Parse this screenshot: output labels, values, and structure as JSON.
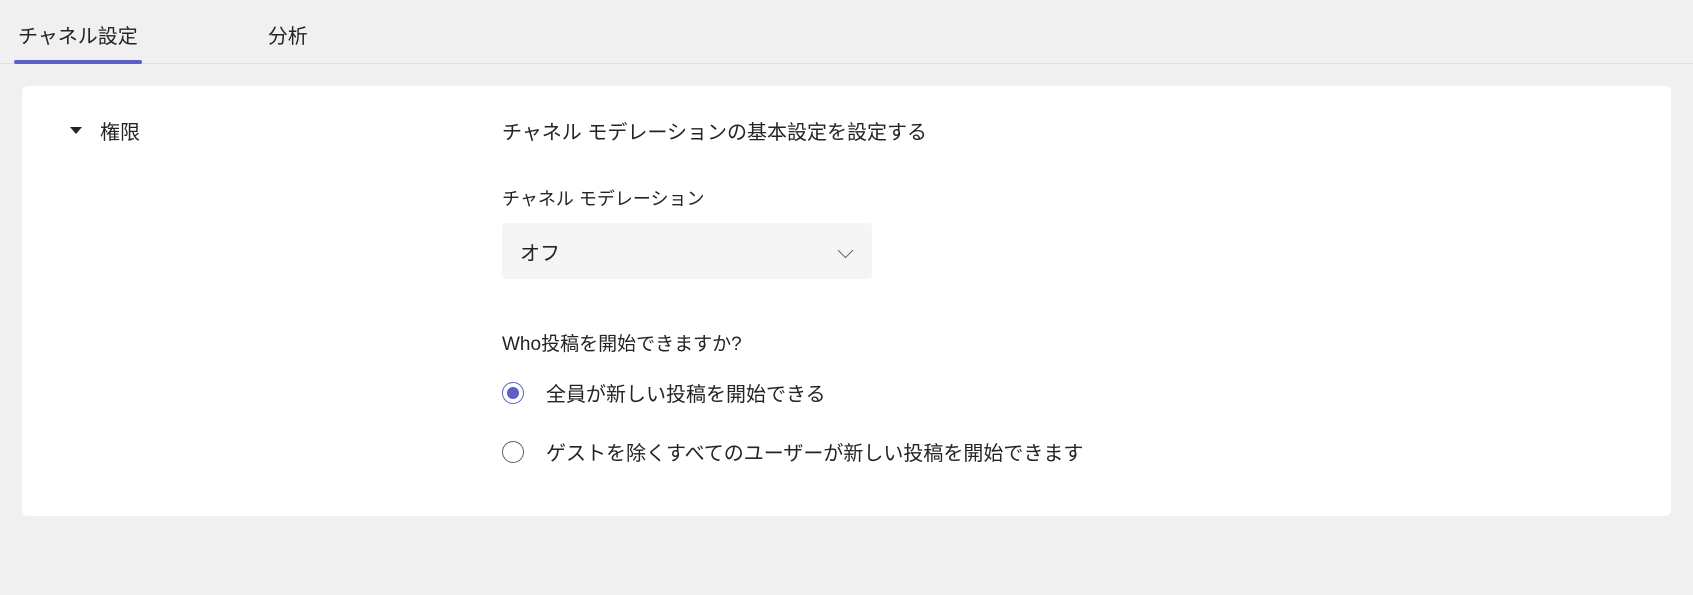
{
  "tabs": {
    "settings": "チャネル設定",
    "analytics": "分析"
  },
  "section": {
    "title": "権限",
    "heading": "チャネル モデレーションの基本設定を設定する"
  },
  "moderation": {
    "label": "チャネル モデレーション",
    "value": "オフ"
  },
  "who_can_post": {
    "question": "Who投稿を開始できますか?",
    "options": [
      "全員が新しい投稿を開始できる",
      "ゲストを除くすべてのユーザーが新しい投稿を開始できます"
    ],
    "selected": 0
  }
}
